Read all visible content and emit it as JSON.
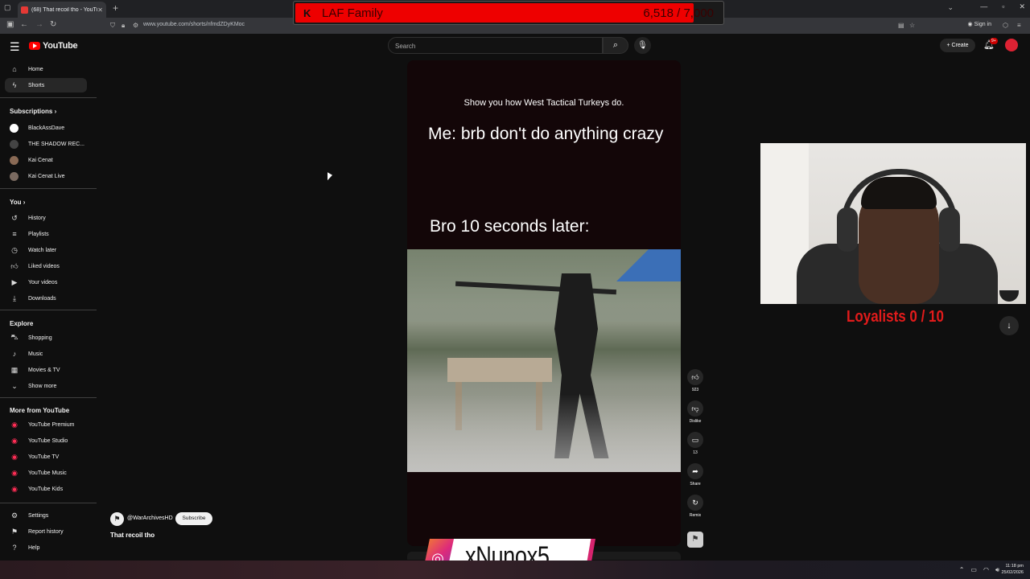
{
  "browser": {
    "tab_title": "(68) That recoil tho - YouTu",
    "url": "www.youtube.com/shorts/nfmdZDyKMoc",
    "signin_label": "Sign in"
  },
  "overlay_laf": {
    "name": "LAF Family",
    "count": "6,518 / 7,000",
    "progress": 0.93
  },
  "header": {
    "logo_text": "YouTube",
    "search_placeholder": "Search",
    "create_label": "Create",
    "notif_badge": "9+"
  },
  "sidebar": {
    "main": [
      {
        "label": "Home",
        "icon": "home-icon"
      },
      {
        "label": "Shorts",
        "icon": "shorts-icon"
      }
    ],
    "subscriptions_heading": "Subscriptions",
    "subscriptions": [
      {
        "label": "BlackAssDave",
        "color": "#ffffff"
      },
      {
        "label": "THE SHADOW REC...",
        "color": "#444444"
      },
      {
        "label": "Kai Cenat",
        "color": "#8a6a55"
      },
      {
        "label": "Kai Cenat Live",
        "color": "#7a6a60"
      }
    ],
    "you_heading": "You",
    "you": [
      {
        "label": "History",
        "icon": "history-icon"
      },
      {
        "label": "Playlists",
        "icon": "playlists-icon"
      },
      {
        "label": "Watch later",
        "icon": "watch-later-icon"
      },
      {
        "label": "Liked videos",
        "icon": "like-icon"
      },
      {
        "label": "Your videos",
        "icon": "your-videos-icon"
      },
      {
        "label": "Downloads",
        "icon": "download-icon"
      }
    ],
    "explore_heading": "Explore",
    "explore": [
      {
        "label": "Shopping",
        "icon": "shopping-icon"
      },
      {
        "label": "Music",
        "icon": "music-icon"
      },
      {
        "label": "Movies & TV",
        "icon": "movies-icon"
      },
      {
        "label": "Show more",
        "icon": "chevron-down-icon"
      }
    ],
    "more_heading": "More from YouTube",
    "more": [
      {
        "label": "YouTube Premium"
      },
      {
        "label": "YouTube Studio"
      },
      {
        "label": "YouTube TV"
      },
      {
        "label": "YouTube Music"
      },
      {
        "label": "YouTube Kids"
      }
    ],
    "footer": [
      {
        "label": "Settings",
        "icon": "gear-icon"
      },
      {
        "label": "Report history",
        "icon": "flag-icon"
      },
      {
        "label": "Help",
        "icon": "help-icon"
      }
    ]
  },
  "short": {
    "caption_top": "Show you how West Tactical Turkeys do.",
    "meme_line1": "Me: brb don't do anything crazy",
    "meme_line2": "Bro 10 seconds later:",
    "channel": "@WarArchivesHD",
    "subscribe_label": "Subscribe",
    "title": "That recoil tho"
  },
  "actions": {
    "likes": "923",
    "dislike": "Dislike",
    "comments": "13",
    "share": "Share",
    "remix": "Remix"
  },
  "overlay_loyalists": "Loyalists  0 / 10",
  "overlay_social": {
    "handle": "xNunox5"
  },
  "taskbar": {
    "time": "11:18 pm",
    "date": "25/02/2026"
  }
}
